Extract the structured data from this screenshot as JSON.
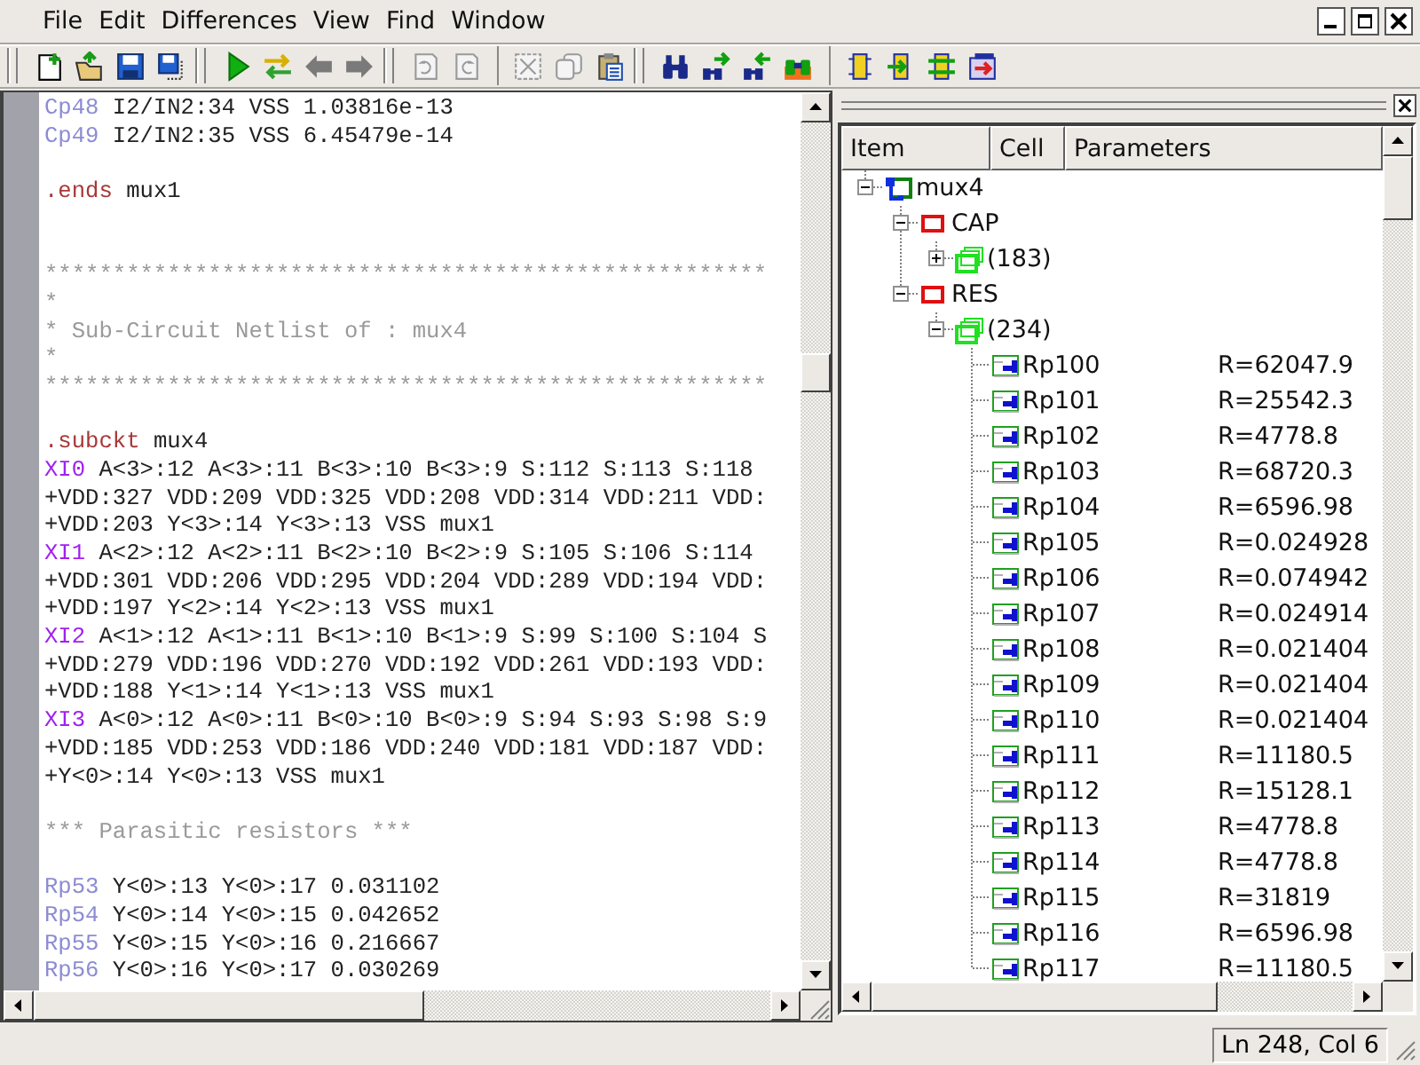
{
  "menu": [
    "File",
    "Edit",
    "Differences",
    "View",
    "Find",
    "Window"
  ],
  "toolbar": {
    "groups": [
      {
        "kind": "grip",
        "buttons": [
          {
            "disabled": false
          },
          {
            "disabled": false
          },
          {
            "disabled": false
          },
          {
            "disabled": false
          }
        ]
      },
      {
        "kind": "grip",
        "buttons": [
          {
            "disabled": false
          },
          {
            "disabled": false
          },
          {
            "disabled": true
          },
          {
            "disabled": true
          }
        ]
      },
      {
        "kind": "grip",
        "buttons": [
          {
            "disabled": true
          },
          {
            "disabled": true
          }
        ]
      },
      {
        "kind": "separator",
        "buttons": [
          {
            "disabled": true
          },
          {
            "disabled": true
          },
          {
            "disabled": false
          }
        ]
      },
      {
        "kind": "grip",
        "buttons": [
          {
            "disabled": false
          },
          {
            "disabled": false
          },
          {
            "disabled": false
          },
          {
            "disabled": false
          }
        ]
      },
      {
        "kind": "separator",
        "buttons": [
          {
            "disabled": false
          },
          {
            "disabled": false
          },
          {
            "disabled": false
          },
          {
            "disabled": false
          }
        ]
      }
    ]
  },
  "editor": {
    "lines": [
      {
        "kind": "code",
        "parts": [
          {
            "kind": "ref",
            "text": "Cp48"
          },
          {
            "kind": "text",
            "text": " I2/IN2:34 VSS 1.03816e-13"
          }
        ]
      },
      {
        "kind": "code",
        "parts": [
          {
            "kind": "ref",
            "text": "Cp49"
          },
          {
            "kind": "text",
            "text": " I2/IN2:35 VSS 6.45479e-14"
          }
        ]
      },
      {
        "kind": "blank"
      },
      {
        "kind": "code",
        "parts": [
          {
            "kind": "directive",
            "text": ".ends"
          },
          {
            "kind": "text",
            "text": " mux1"
          }
        ]
      },
      {
        "kind": "blank"
      },
      {
        "kind": "blank"
      },
      {
        "kind": "code",
        "parts": [
          {
            "kind": "comment",
            "text": "*****************************************************"
          }
        ]
      },
      {
        "kind": "code",
        "parts": [
          {
            "kind": "comment",
            "text": "*"
          }
        ]
      },
      {
        "kind": "code",
        "parts": [
          {
            "kind": "comment",
            "text": "* Sub-Circuit Netlist of : mux4"
          }
        ]
      },
      {
        "kind": "code",
        "parts": [
          {
            "kind": "comment",
            "text": "*"
          }
        ]
      },
      {
        "kind": "code",
        "parts": [
          {
            "kind": "comment",
            "text": "*****************************************************"
          }
        ]
      },
      {
        "kind": "blank"
      },
      {
        "kind": "code",
        "parts": [
          {
            "kind": "directive",
            "text": ".subckt"
          },
          {
            "kind": "text",
            "text": " mux4"
          }
        ]
      },
      {
        "kind": "code",
        "parts": [
          {
            "kind": "instance",
            "text": "XI0"
          },
          {
            "kind": "text",
            "text": " A<3>:12 A<3>:11 B<3>:10 B<3>:9 S:112 S:113 S:118"
          }
        ]
      },
      {
        "kind": "code",
        "parts": [
          {
            "kind": "text",
            "text": "+VDD:327 VDD:209 VDD:325 VDD:208 VDD:314 VDD:211 VDD:"
          }
        ]
      },
      {
        "kind": "code",
        "parts": [
          {
            "kind": "text",
            "text": "+VDD:203 Y<3>:14 Y<3>:13 VSS mux1"
          }
        ]
      },
      {
        "kind": "code",
        "parts": [
          {
            "kind": "instance",
            "text": "XI1"
          },
          {
            "kind": "text",
            "text": " A<2>:12 A<2>:11 B<2>:10 B<2>:9 S:105 S:106 S:114"
          }
        ]
      },
      {
        "kind": "code",
        "parts": [
          {
            "kind": "text",
            "text": "+VDD:301 VDD:206 VDD:295 VDD:204 VDD:289 VDD:194 VDD:"
          }
        ]
      },
      {
        "kind": "code",
        "parts": [
          {
            "kind": "text",
            "text": "+VDD:197 Y<2>:14 Y<2>:13 VSS mux1"
          }
        ]
      },
      {
        "kind": "code",
        "parts": [
          {
            "kind": "instance",
            "text": "XI2"
          },
          {
            "kind": "text",
            "text": " A<1>:12 A<1>:11 B<1>:10 B<1>:9 S:99 S:100 S:104 S"
          }
        ]
      },
      {
        "kind": "code",
        "parts": [
          {
            "kind": "text",
            "text": "+VDD:279 VDD:196 VDD:270 VDD:192 VDD:261 VDD:193 VDD:"
          }
        ]
      },
      {
        "kind": "code",
        "parts": [
          {
            "kind": "text",
            "text": "+VDD:188 Y<1>:14 Y<1>:13 VSS mux1"
          }
        ]
      },
      {
        "kind": "code",
        "parts": [
          {
            "kind": "instance",
            "text": "XI3"
          },
          {
            "kind": "text",
            "text": " A<0>:12 A<0>:11 B<0>:10 B<0>:9 S:94 S:93 S:98 S:9"
          }
        ]
      },
      {
        "kind": "code",
        "parts": [
          {
            "kind": "text",
            "text": "+VDD:185 VDD:253 VDD:186 VDD:240 VDD:181 VDD:187 VDD:"
          }
        ]
      },
      {
        "kind": "code",
        "parts": [
          {
            "kind": "text",
            "text": "+Y<0>:14 Y<0>:13 VSS mux1"
          }
        ]
      },
      {
        "kind": "blank"
      },
      {
        "kind": "code",
        "parts": [
          {
            "kind": "comment",
            "text": "*** Parasitic resistors ***"
          }
        ]
      },
      {
        "kind": "blank"
      },
      {
        "kind": "code",
        "parts": [
          {
            "kind": "ref",
            "text": "Rp53"
          },
          {
            "kind": "text",
            "text": " Y<0>:13 Y<0>:17 0.031102"
          }
        ]
      },
      {
        "kind": "code",
        "parts": [
          {
            "kind": "ref",
            "text": "Rp54"
          },
          {
            "kind": "text",
            "text": " Y<0>:14 Y<0>:15 0.042652"
          }
        ]
      },
      {
        "kind": "code",
        "parts": [
          {
            "kind": "ref",
            "text": "Rp55"
          },
          {
            "kind": "text",
            "text": " Y<0>:15 Y<0>:16 0.216667"
          }
        ]
      },
      {
        "kind": "code",
        "parts": [
          {
            "kind": "ref",
            "text": "Rp56"
          },
          {
            "kind": "text",
            "text": " Y<0>:16 Y<0>:17 0.030269"
          }
        ]
      }
    ]
  },
  "tree": {
    "columns": [
      "Item",
      "Cell",
      "Parameters"
    ],
    "nodes": [
      {
        "kind": "subckt",
        "label": "mux4",
        "expanded": true,
        "children": [
          {
            "kind": "type",
            "label": "CAP",
            "expanded": true,
            "children": [
              {
                "kind": "group",
                "label": "(183)",
                "expanded": false
              }
            ]
          },
          {
            "kind": "type",
            "label": "RES",
            "expanded": true,
            "children": [
              {
                "kind": "group",
                "label": "(234)",
                "expanded": true,
                "children": [
                  {
                    "kind": "element",
                    "label": "Rp100",
                    "parameters": "R=62047.9"
                  },
                  {
                    "kind": "element",
                    "label": "Rp101",
                    "parameters": "R=25542.3"
                  },
                  {
                    "kind": "element",
                    "label": "Rp102",
                    "parameters": "R=4778.8"
                  },
                  {
                    "kind": "element",
                    "label": "Rp103",
                    "parameters": "R=68720.3"
                  },
                  {
                    "kind": "element",
                    "label": "Rp104",
                    "parameters": "R=6596.98"
                  },
                  {
                    "kind": "element",
                    "label": "Rp105",
                    "parameters": "R=0.024928"
                  },
                  {
                    "kind": "element",
                    "label": "Rp106",
                    "parameters": "R=0.074942"
                  },
                  {
                    "kind": "element",
                    "label": "Rp107",
                    "parameters": "R=0.024914"
                  },
                  {
                    "kind": "element",
                    "label": "Rp108",
                    "parameters": "R=0.021404"
                  },
                  {
                    "kind": "element",
                    "label": "Rp109",
                    "parameters": "R=0.021404"
                  },
                  {
                    "kind": "element",
                    "label": "Rp110",
                    "parameters": "R=0.021404"
                  },
                  {
                    "kind": "element",
                    "label": "Rp111",
                    "parameters": "R=11180.5"
                  },
                  {
                    "kind": "element",
                    "label": "Rp112",
                    "parameters": "R=15128.1"
                  },
                  {
                    "kind": "element",
                    "label": "Rp113",
                    "parameters": "R=4778.8"
                  },
                  {
                    "kind": "element",
                    "label": "Rp114",
                    "parameters": "R=4778.8"
                  },
                  {
                    "kind": "element",
                    "label": "Rp115",
                    "parameters": "R=31819"
                  },
                  {
                    "kind": "element",
                    "label": "Rp116",
                    "parameters": "R=6596.98"
                  },
                  {
                    "kind": "element",
                    "label": "Rp117",
                    "parameters": "R=11180.5"
                  }
                ]
              }
            ]
          }
        ]
      }
    ]
  },
  "status_bar": {
    "position": "Ln 248, Col 6"
  }
}
